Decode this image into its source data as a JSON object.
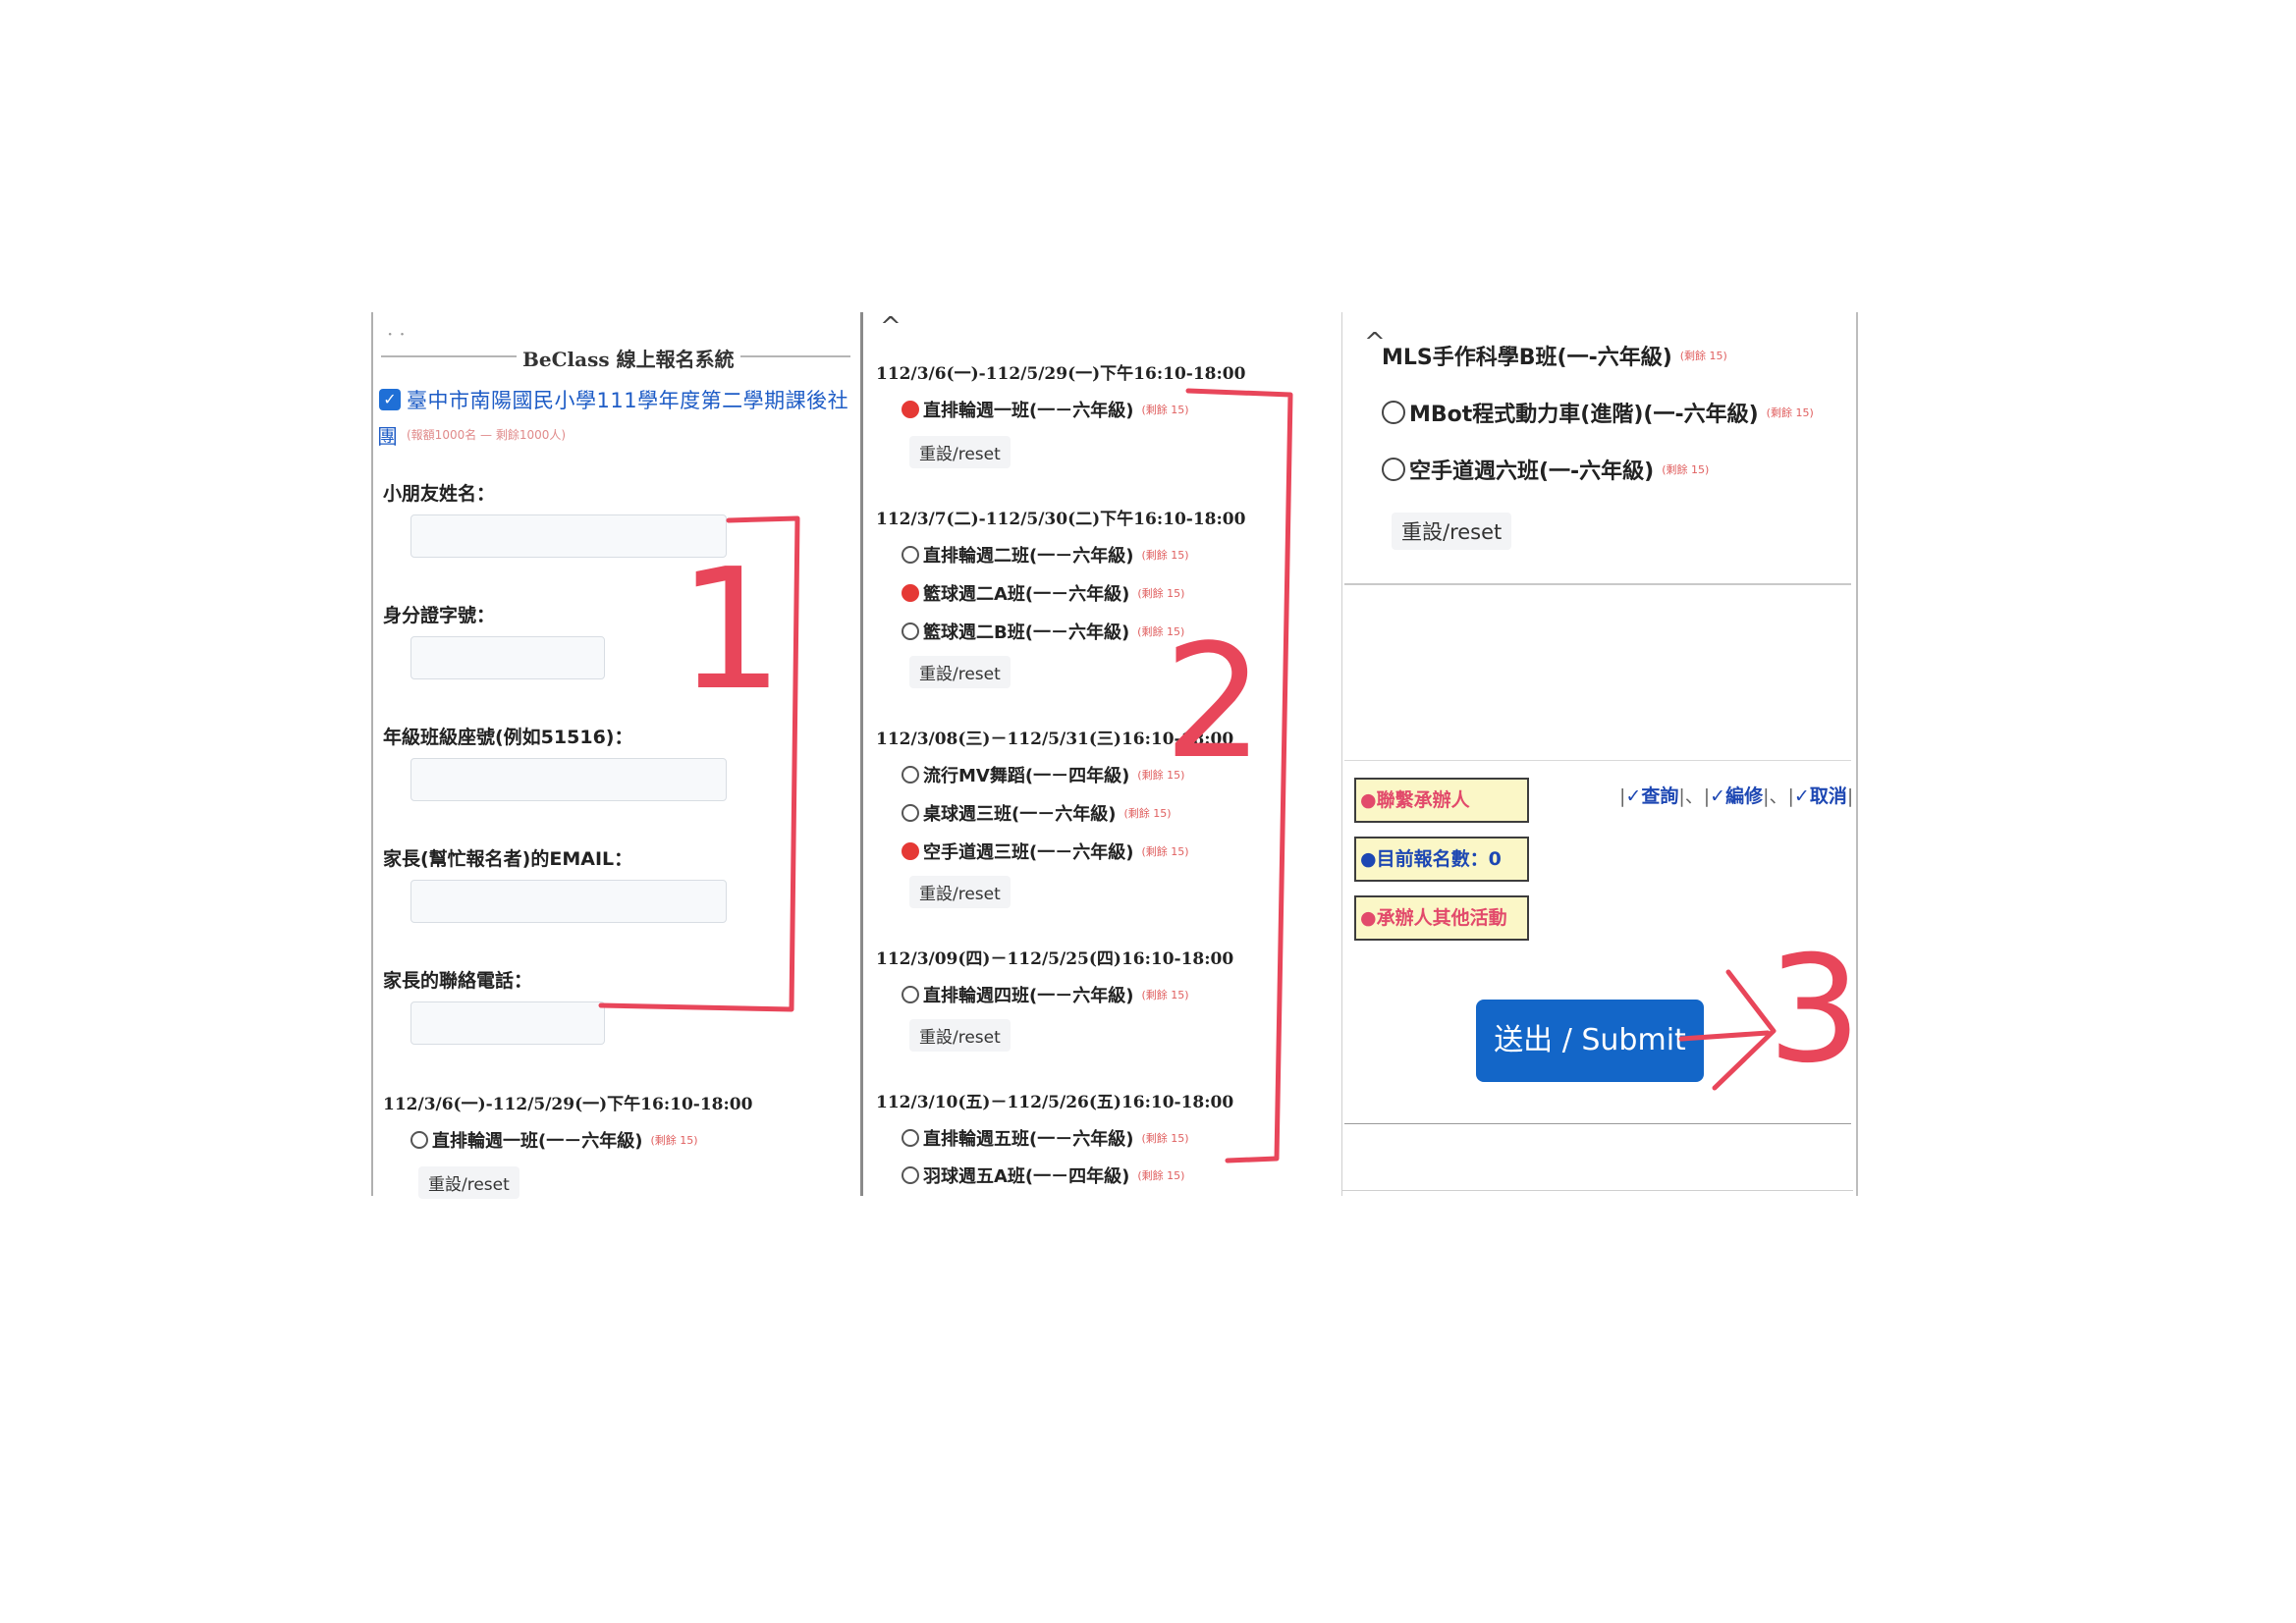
{
  "panel1": {
    "system_title": "BeClass 線上報名系統",
    "org_title": "臺中市南陽國民小學111學年度第二學期課後社",
    "org_title_tail": "團",
    "org_quota": "(報額1000名 — 剩餘1000人)",
    "fields": [
      {
        "label": "小朋友姓名："
      },
      {
        "label": "身分證字號："
      },
      {
        "label": "年級班級座號(例如51516)："
      },
      {
        "label": "家長(幫忙報名者)的EMAIL："
      },
      {
        "label": "家長的聯絡電話："
      }
    ],
    "session": {
      "header": "112/3/6(一)-112/5/29(一)下午16:10-18:00",
      "option_label": "直排輪週一班(一－六年級)",
      "option_quota": "(剩餘 15)",
      "reset": "重設/reset"
    }
  },
  "panel2": {
    "sessions": [
      {
        "header": "112/3/6(一)-112/5/29(一)下午16:10-18:00",
        "options": [
          {
            "label": "直排輪週一班(一－六年級)",
            "quota": "(剩餘 15)",
            "marked": true
          }
        ],
        "reset": "重設/reset"
      },
      {
        "header": "112/3/7(二)-112/5/30(二)下午16:10-18:00",
        "options": [
          {
            "label": "直排輪週二班(一－六年級)",
            "quota": "(剩餘 15)",
            "marked": false
          },
          {
            "label": "籃球週二A班(一－六年級)",
            "quota": "(剩餘 15)",
            "marked": true
          },
          {
            "label": "籃球週二B班(一－六年級)",
            "quota": "(剩餘 15)",
            "marked": false
          }
        ],
        "reset": "重設/reset"
      },
      {
        "header": "112/3/08(三)－112/5/31(三)16:10-18:00",
        "options": [
          {
            "label": "流行MV舞蹈(一－四年級)",
            "quota": "(剩餘 15)",
            "marked": false
          },
          {
            "label": "桌球週三班(一－六年級)",
            "quota": "(剩餘 15)",
            "marked": false
          },
          {
            "label": "空手道週三班(一－六年級)",
            "quota": "(剩餘 15)",
            "marked": true
          }
        ],
        "reset": "重設/reset"
      },
      {
        "header": "112/3/09(四)－112/5/25(四)16:10-18:00",
        "options": [
          {
            "label": "直排輪週四班(一－六年級)",
            "quota": "(剩餘 15)",
            "marked": false
          }
        ],
        "reset": "重設/reset"
      },
      {
        "header": "112/3/10(五)－112/5/26(五)16:10-18:00",
        "options": [
          {
            "label": "直排輪週五班(一－六年級)",
            "quota": "(剩餘 15)",
            "marked": false
          },
          {
            "label": "羽球週五A班(一－四年級)",
            "quota": "(剩餘 15)",
            "marked": false
          }
        ]
      }
    ]
  },
  "panel3": {
    "options": [
      {
        "label": "MLS手作科學B班(一-六年級)",
        "quota": "(剩餘 15)"
      },
      {
        "label": "MBot程式動力車(進階)(一-六年級)",
        "quota": "(剩餘 15)"
      },
      {
        "label": "空手道週六班(一-六年級)",
        "quota": "(剩餘 15)"
      }
    ],
    "reset": "重設/reset",
    "buttons": {
      "contact": "●聯繫承辦人",
      "count": "●目前報名數：0",
      "other": "●承辦人其他活動"
    },
    "links": {
      "query": "查詢",
      "edit": "編修",
      "cancel": "取消"
    },
    "submit": "送出 / Submit"
  },
  "annotations": {
    "step1": "1",
    "step2": "2",
    "step3": "3",
    "color": "#e8465a"
  }
}
